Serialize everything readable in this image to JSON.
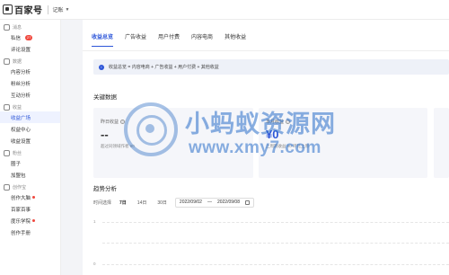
{
  "topbar": {
    "logo_text": "百家号",
    "account_label": "记账"
  },
  "sidebar": {
    "sections": [
      {
        "head": "消息",
        "items": [
          {
            "label": "私信",
            "badge": "27"
          },
          {
            "label": "评论设置"
          }
        ]
      },
      {
        "head": "数据",
        "items": [
          {
            "label": "内容分析"
          },
          {
            "label": "粉丝分析"
          },
          {
            "label": "互动分析"
          }
        ]
      },
      {
        "head": "收益",
        "items": [
          {
            "label": "收益广场",
            "active": true
          },
          {
            "label": "权益中心"
          },
          {
            "label": "收益设置"
          }
        ]
      },
      {
        "head": "粉丝",
        "items": [
          {
            "label": "圈子"
          },
          {
            "label": "加盟包"
          }
        ]
      },
      {
        "head": "创作宝",
        "items": [
          {
            "label": "创作大脑",
            "dot": true
          },
          {
            "label": "百家百事"
          },
          {
            "label": "度乐学院",
            "dot": true
          },
          {
            "label": "创作手册"
          }
        ]
      }
    ]
  },
  "tabs": [
    {
      "label": "收益总览",
      "active": true
    },
    {
      "label": "广告收益"
    },
    {
      "label": "用户付费"
    },
    {
      "label": "内容电商"
    },
    {
      "label": "其他收益"
    }
  ],
  "notice": {
    "text": "收益总览 = 内容电商 + 广告收益 + 用户付费 + 其他收益"
  },
  "key_data": {
    "title": "关键数据",
    "cards": [
      {
        "label": "昨日收益",
        "value": "--",
        "sub": "超过同领域作者 ¥0"
      },
      {
        "label": "本月收益",
        "value": "¥0",
        "sub": "上周期收益 ¥0  环比上周"
      },
      {
        "label": "",
        "value": "",
        "sub": ""
      }
    ]
  },
  "trend": {
    "title": "趋势分析",
    "time_label": "时间选择",
    "ranges": [
      "7日",
      "14日",
      "30日"
    ],
    "date_start": "2022/09/02",
    "date_sep": "—",
    "date_end": "2022/09/08",
    "y_ticks": [
      "1",
      "",
      "0"
    ]
  },
  "watermark": {
    "cn": "小蚂蚁资源网",
    "url": "www.xmy7.com"
  },
  "colors": {
    "accent": "#2d56d8",
    "badge": "#f0483e"
  }
}
